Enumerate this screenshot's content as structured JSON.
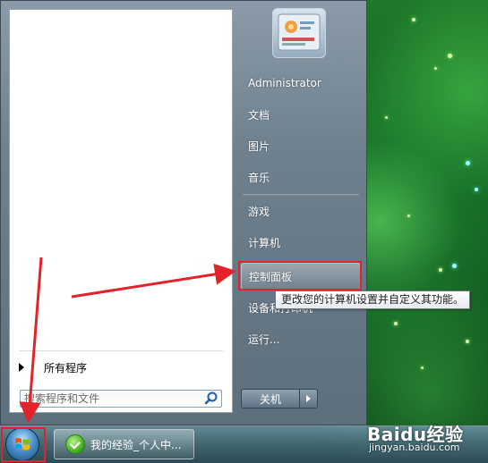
{
  "start_menu": {
    "all_programs": "所有程序",
    "search": {
      "placeholder": "搜索程序和文件",
      "value": ""
    },
    "right_items": [
      "Administrator",
      "文档",
      "图片",
      "音乐",
      "游戏",
      "计算机",
      "控制面板",
      "设备和打印机",
      "运行..."
    ],
    "shutdown_label": "关机"
  },
  "tooltip": "更改您的计算机设置并自定义其功能。",
  "taskbar": {
    "items": [
      {
        "label": "我的经验_个人中..."
      }
    ]
  },
  "watermark": {
    "logo": "Baidu经验",
    "url": "jingyan.baidu.com"
  },
  "annotation_color": "#e2232a"
}
